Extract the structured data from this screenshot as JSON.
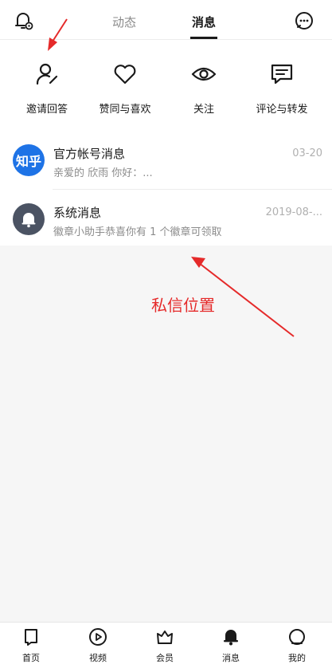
{
  "header": {
    "tabs": [
      {
        "label": "动态",
        "active": false
      },
      {
        "label": "消息",
        "active": true
      }
    ],
    "left_icon": "bell-settings-icon",
    "right_icon": "chat-bubble-icon"
  },
  "quick_actions": [
    {
      "label": "邀请回答",
      "icon": "user-edit-icon"
    },
    {
      "label": "赞同与喜欢",
      "icon": "heart-icon"
    },
    {
      "label": "关注",
      "icon": "eye-icon"
    },
    {
      "label": "评论与转发",
      "icon": "comment-icon"
    }
  ],
  "messages": [
    {
      "avatar_text": "知乎",
      "title": "官方帐号消息",
      "preview": "亲爱的 欣雨 你好：...",
      "time": "03-20"
    },
    {
      "avatar_icon": "bell-icon",
      "title": "系统消息",
      "preview": "徽章小助手恭喜你有 1 个徽章可领取",
      "time": "2019-08-..."
    }
  ],
  "annotation": {
    "text": "私信位置",
    "color": "#e52a2a"
  },
  "bottom_nav": [
    {
      "label": "首页",
      "icon": "bookmark-icon"
    },
    {
      "label": "视频",
      "icon": "play-icon"
    },
    {
      "label": "会员",
      "icon": "crown-icon"
    },
    {
      "label": "消息",
      "icon": "bell-icon"
    },
    {
      "label": "我的",
      "icon": "profile-icon"
    }
  ],
  "colors": {
    "zhihu_blue": "#1e73e6",
    "system_avatar": "#4b5363",
    "background": "#f6f6f6"
  }
}
